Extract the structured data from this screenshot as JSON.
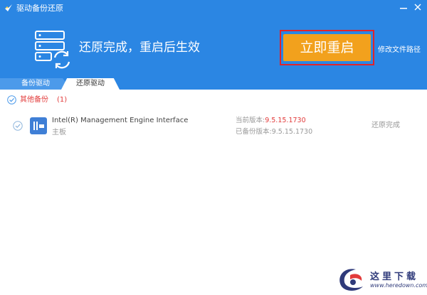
{
  "window": {
    "title": "驱动备份还原",
    "minimize_icon": "minimize-icon",
    "close_icon": "close-icon"
  },
  "hero": {
    "icon": "server-restore-icon",
    "message": "还原完成，重启后生效",
    "restart_label": "立即重启",
    "path_link": "修改文件路径"
  },
  "tabs": [
    {
      "label": "备份驱动",
      "active": false
    },
    {
      "label": "还原驱动",
      "active": true
    }
  ],
  "group": {
    "label": "其他备份",
    "count": "(1)",
    "checked": true
  },
  "rows": [
    {
      "checked": true,
      "icon": "network-adapter-icon",
      "name": "Intel(R) Management Engine Interface",
      "category": "主板",
      "current_label": "当前版本:",
      "current_version": "9.5.15.1730",
      "backup_label": "已备份版本:",
      "backup_version": "9.5.15.1730",
      "status": "还原完成"
    }
  ],
  "watermark": {
    "name": "这里下载",
    "url": "www.heredown.com"
  },
  "colors": {
    "header": "#2b86e3",
    "restart_button": "#f2a11d",
    "highlight_frame": "#e0242b",
    "accent_red": "#e23b3b"
  }
}
